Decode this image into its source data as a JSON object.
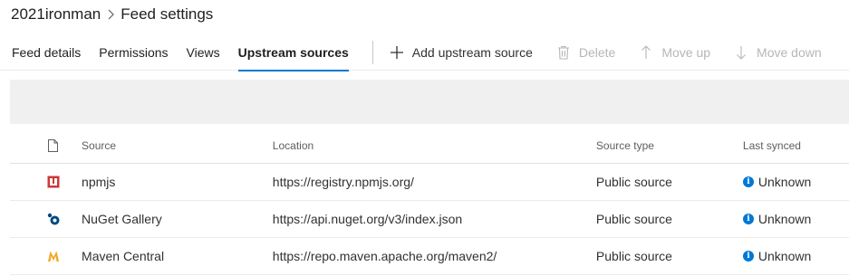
{
  "breadcrumb": {
    "root": "2021ironman",
    "current": "Feed settings"
  },
  "tabs": [
    {
      "label": "Feed details",
      "active": false
    },
    {
      "label": "Permissions",
      "active": false
    },
    {
      "label": "Views",
      "active": false
    },
    {
      "label": "Upstream sources",
      "active": true
    }
  ],
  "commands": {
    "add": "Add upstream source",
    "delete": "Delete",
    "move_up": "Move up",
    "move_down": "Move down"
  },
  "table": {
    "columns": {
      "source": "Source",
      "location": "Location",
      "type": "Source type",
      "synced": "Last synced"
    },
    "rows": [
      {
        "icon": "npm-icon",
        "source": "npmjs",
        "location": "https://registry.npmjs.org/",
        "type": "Public source",
        "synced": "Unknown"
      },
      {
        "icon": "nuget-icon",
        "source": "NuGet Gallery",
        "location": "https://api.nuget.org/v3/index.json",
        "type": "Public source",
        "synced": "Unknown"
      },
      {
        "icon": "maven-icon",
        "source": "Maven Central",
        "location": "https://repo.maven.apache.org/maven2/",
        "type": "Public source",
        "synced": "Unknown"
      }
    ]
  },
  "colors": {
    "accent": "#0078d4",
    "npm": "#cb3837",
    "nuget": "#004880",
    "maven": "#f5a623",
    "banner": "#f0f0f0"
  }
}
